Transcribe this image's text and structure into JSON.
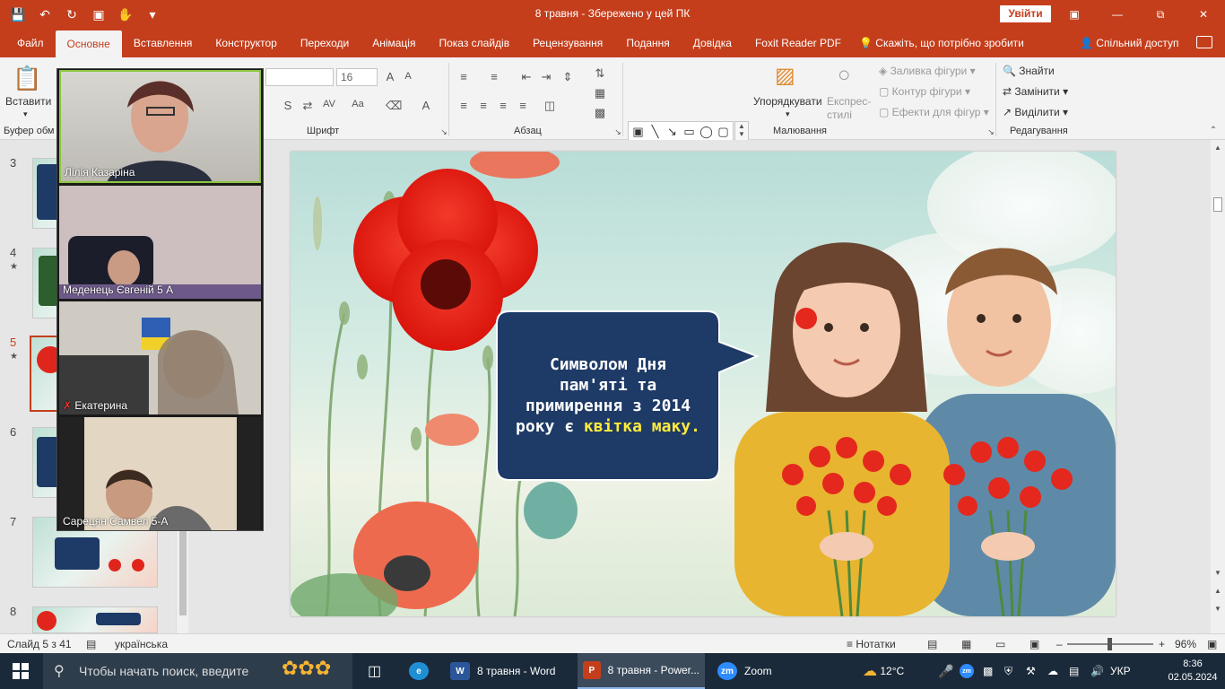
{
  "titlebar": {
    "doc_title": "8 травня  -  Збережено у цей ПК",
    "signin_label": "Увійти"
  },
  "tabs": [
    "Файл",
    "Основне",
    "Вставлення",
    "Конструктор",
    "Переходи",
    "Анімація",
    "Показ слайдів",
    "Рецензування",
    "Подання",
    "Довідка",
    "Foxit Reader PDF"
  ],
  "tellme": "Скажіть, що потрібно зробити",
  "share": "Спільний доступ",
  "ribbon": {
    "paste_label": "Вставити",
    "clipboard_label": "Буфер обм",
    "font_size": "16",
    "font_label": "Шрифт",
    "paragraph_label": "Абзац",
    "drawing_label": "Малювання",
    "arrange_label": "Упорядкувати",
    "quick_styles_label": "Експрес-стилі",
    "shape_fill": "Заливка фігури",
    "shape_outline": "Контур фігури",
    "shape_effects": "Ефекти для фігур",
    "find": "Знайти",
    "replace": "Замінити",
    "select": "Виділити",
    "editing_label": "Редагування"
  },
  "thumbnails": [
    {
      "num": "3",
      "star": false,
      "selected": false
    },
    {
      "num": "4",
      "star": true,
      "selected": false
    },
    {
      "num": "5",
      "star": true,
      "selected": true
    },
    {
      "num": "6",
      "star": false,
      "selected": false
    },
    {
      "num": "7",
      "star": false,
      "selected": false
    },
    {
      "num": "8",
      "star": false,
      "selected": false
    }
  ],
  "slide": {
    "bubble_line1": "Символом Дня",
    "bubble_line2": "пам'яті та",
    "bubble_line3": "примирення з 2014",
    "bubble_line4_pre": "року є ",
    "bubble_highlight": "квітка маку.",
    "highlight_color": "#ffeb3b",
    "bubble_color": "#1e3a66"
  },
  "zoom_participants": [
    {
      "name": "Лілія Казаріна",
      "muted": false,
      "active": true
    },
    {
      "name": "Меденець Євгеній 5 А",
      "muted": false,
      "active": false
    },
    {
      "name": "Екатерина",
      "muted": true,
      "active": false
    },
    {
      "name": "Сарецян Самвел 5-А",
      "muted": false,
      "active": false
    }
  ],
  "statusbar": {
    "slide_counter": "Слайд 5 з 41",
    "language": "українська",
    "notes": "Нотатки",
    "zoom": "96%"
  },
  "taskbar": {
    "search_placeholder": "Чтобы начать поиск, введите",
    "word": "8 травня - Word",
    "powerpoint": "8 травня - Power...",
    "zoom_app": "Zoom",
    "temperature": "12°C",
    "lang": "УКР",
    "time": "8:36",
    "date": "02.05.2024"
  },
  "colors": {
    "accent": "#c43e1c",
    "taskbar": "#1b2a3a"
  }
}
